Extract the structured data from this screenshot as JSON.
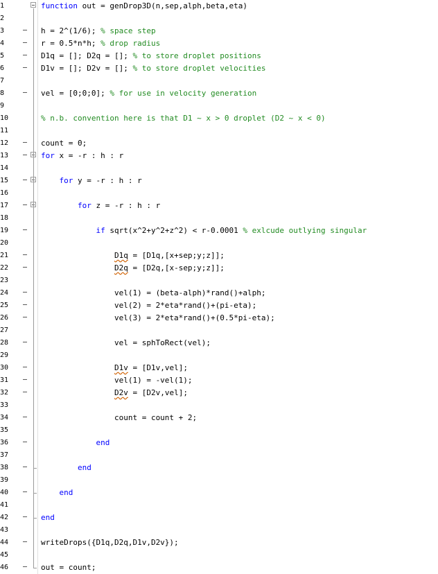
{
  "editor": {
    "lines": [
      {
        "n": "1",
        "fold": "box",
        "tokens": [
          {
            "t": "function",
            "c": "kw"
          },
          {
            "t": " out = genDrop3D(n,sep,alph,beta,eta)"
          }
        ]
      },
      {
        "n": "2",
        "tokens": []
      },
      {
        "n": "3",
        "dash": true,
        "tokens": [
          {
            "t": "h = 2^(1/6); "
          },
          {
            "t": "% space step",
            "c": "cm"
          }
        ]
      },
      {
        "n": "4",
        "dash": true,
        "tokens": [
          {
            "t": "r = 0.5*n*h; "
          },
          {
            "t": "% drop radius",
            "c": "cm"
          }
        ]
      },
      {
        "n": "5",
        "dash": true,
        "tokens": [
          {
            "t": "D1q = []; D2q = []; "
          },
          {
            "t": "% to store droplet positions",
            "c": "cm"
          }
        ]
      },
      {
        "n": "6",
        "dash": true,
        "tokens": [
          {
            "t": "D1v = []; D2v = []; "
          },
          {
            "t": "% to store droplet velocities",
            "c": "cm"
          }
        ]
      },
      {
        "n": "7",
        "tokens": []
      },
      {
        "n": "8",
        "dash": true,
        "tokens": [
          {
            "t": "vel = [0;0;0]; "
          },
          {
            "t": "% for use in velocity generation",
            "c": "cm"
          }
        ]
      },
      {
        "n": "9",
        "tokens": []
      },
      {
        "n": "10",
        "tokens": [
          {
            "t": "% n.b. convention here is that D1 ~ x > 0 droplet (D2 ~ x < 0)",
            "c": "cm"
          }
        ]
      },
      {
        "n": "11",
        "tokens": []
      },
      {
        "n": "12",
        "dash": true,
        "tokens": [
          {
            "t": "count = 0;"
          }
        ]
      },
      {
        "n": "13",
        "dash": true,
        "fold": "box",
        "tokens": [
          {
            "t": "for",
            "c": "kw"
          },
          {
            "t": " x = -r : h : r"
          }
        ]
      },
      {
        "n": "14",
        "tokens": []
      },
      {
        "n": "15",
        "dash": true,
        "fold": "box",
        "tokens": [
          {
            "t": "    "
          },
          {
            "t": "for",
            "c": "kw"
          },
          {
            "t": " y = -r : h : r"
          }
        ]
      },
      {
        "n": "16",
        "tokens": []
      },
      {
        "n": "17",
        "dash": true,
        "fold": "box",
        "tokens": [
          {
            "t": "        "
          },
          {
            "t": "for",
            "c": "kw"
          },
          {
            "t": " z = -r : h : r"
          }
        ]
      },
      {
        "n": "18",
        "tokens": []
      },
      {
        "n": "19",
        "dash": true,
        "tokens": [
          {
            "t": "            "
          },
          {
            "t": "if",
            "c": "kw"
          },
          {
            "t": " sqrt(x^2+y^2+z^2) < r-0.0001 "
          },
          {
            "t": "% exlcude outlying singular",
            "c": "cm"
          }
        ]
      },
      {
        "n": "20",
        "tokens": []
      },
      {
        "n": "21",
        "dash": true,
        "tokens": [
          {
            "t": "                "
          },
          {
            "t": "D1q",
            "c": "sq"
          },
          {
            "t": " = [D1q,[x+sep;y;z]];"
          }
        ]
      },
      {
        "n": "22",
        "dash": true,
        "tokens": [
          {
            "t": "                "
          },
          {
            "t": "D2q",
            "c": "sq"
          },
          {
            "t": " = [D2q,[x-sep;y;z]];"
          }
        ]
      },
      {
        "n": "23",
        "tokens": []
      },
      {
        "n": "24",
        "dash": true,
        "tokens": [
          {
            "t": "                vel(1) = (beta-alph)*rand()+alph;"
          }
        ]
      },
      {
        "n": "25",
        "dash": true,
        "tokens": [
          {
            "t": "                vel(2) = 2*eta*rand()+(pi-eta);"
          }
        ]
      },
      {
        "n": "26",
        "dash": true,
        "tokens": [
          {
            "t": "                vel(3) = 2*eta*rand()+(0.5*pi-eta);"
          }
        ]
      },
      {
        "n": "27",
        "tokens": []
      },
      {
        "n": "28",
        "dash": true,
        "tokens": [
          {
            "t": "                vel = sphToRect(vel);"
          }
        ]
      },
      {
        "n": "29",
        "tokens": []
      },
      {
        "n": "30",
        "dash": true,
        "tokens": [
          {
            "t": "                "
          },
          {
            "t": "D1v",
            "c": "sq"
          },
          {
            "t": " = [D1v,vel];"
          }
        ]
      },
      {
        "n": "31",
        "dash": true,
        "tokens": [
          {
            "t": "                vel(1) = -vel(1);"
          }
        ]
      },
      {
        "n": "32",
        "dash": true,
        "tokens": [
          {
            "t": "                "
          },
          {
            "t": "D2v",
            "c": "sq"
          },
          {
            "t": " = [D2v,vel];"
          }
        ]
      },
      {
        "n": "33",
        "tokens": []
      },
      {
        "n": "34",
        "dash": true,
        "tokens": [
          {
            "t": "                count = count + 2;"
          }
        ]
      },
      {
        "n": "35",
        "tokens": []
      },
      {
        "n": "36",
        "dash": true,
        "tokens": [
          {
            "t": "            "
          },
          {
            "t": "end",
            "c": "kw"
          }
        ]
      },
      {
        "n": "37",
        "tokens": []
      },
      {
        "n": "38",
        "dash": true,
        "tokens": [
          {
            "t": "        "
          },
          {
            "t": "end",
            "c": "kw"
          }
        ]
      },
      {
        "n": "39",
        "tokens": []
      },
      {
        "n": "40",
        "dash": true,
        "tokens": [
          {
            "t": "    "
          },
          {
            "t": "end",
            "c": "kw"
          }
        ]
      },
      {
        "n": "41",
        "tokens": []
      },
      {
        "n": "42",
        "dash": true,
        "tokens": [
          {
            "t": "end",
            "c": "kw"
          }
        ]
      },
      {
        "n": "43",
        "tokens": []
      },
      {
        "n": "44",
        "dash": true,
        "tokens": [
          {
            "t": "writeDrops({D1q,D2q,D1v,D2v});"
          }
        ]
      },
      {
        "n": "45",
        "tokens": []
      },
      {
        "n": "46",
        "dash": true,
        "tokens": [
          {
            "t": "out = count;"
          }
        ]
      }
    ]
  }
}
